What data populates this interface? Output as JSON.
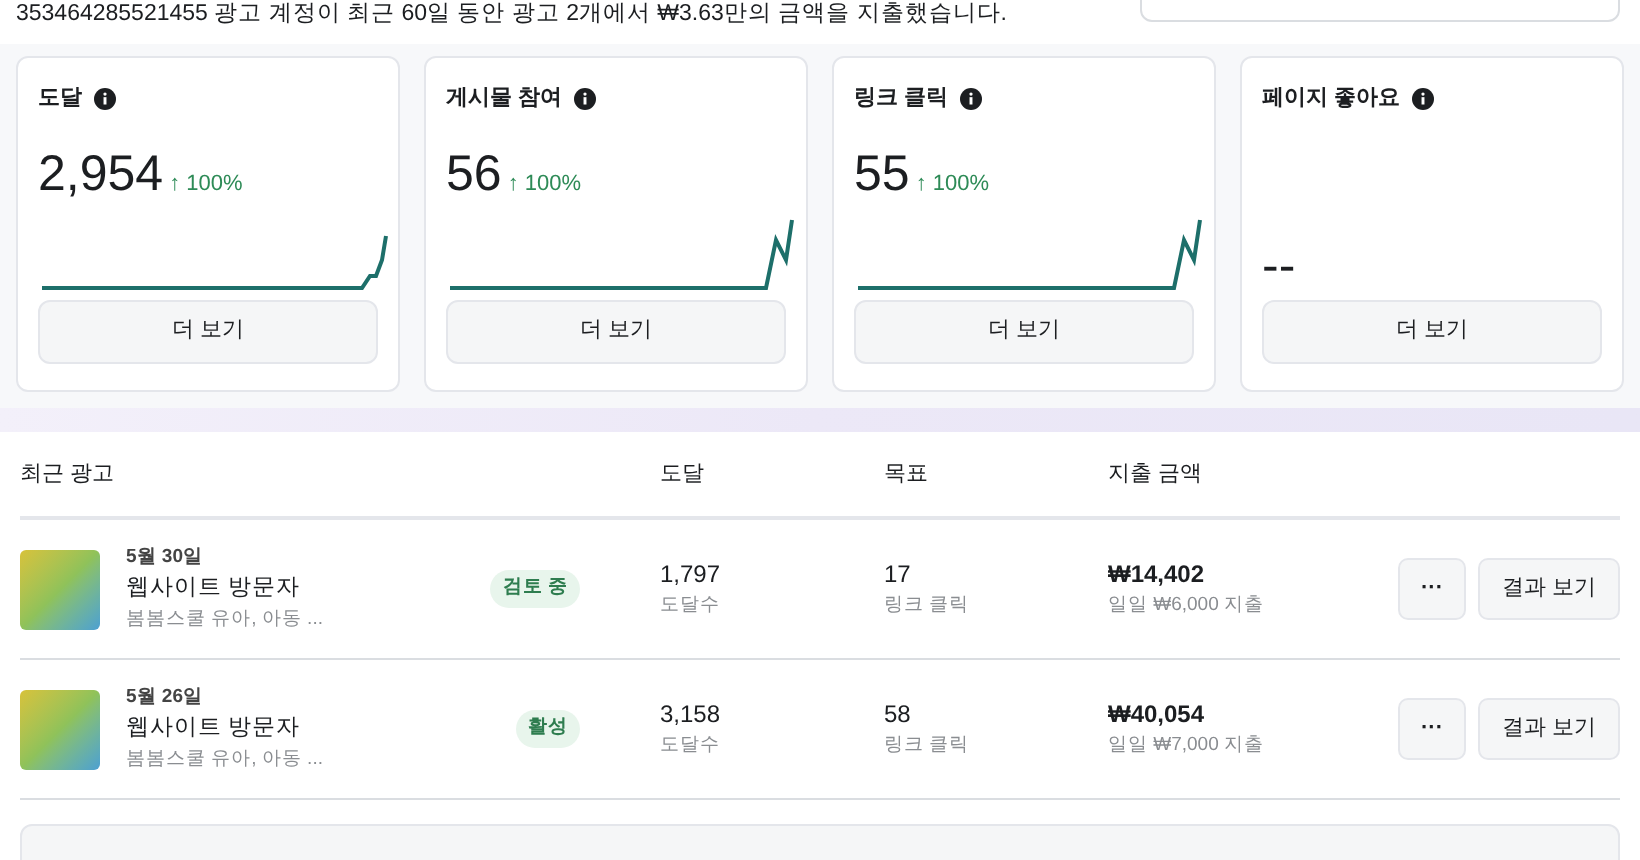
{
  "summary": "353464285521455 광고 계정이 최근 60일 동안 광고 2개에서 ₩3.63만의 금액을 지출했습니다.",
  "metrics": [
    {
      "label": "도달",
      "value": "2,954",
      "delta": "↑ 100%",
      "sparkline": true
    },
    {
      "label": "게시물 참여",
      "value": "56",
      "delta": "↑ 100%",
      "sparkline": true
    },
    {
      "label": "링크 클릭",
      "value": "55",
      "delta": "↑ 100%",
      "sparkline": true
    },
    {
      "label": "페이지 좋아요",
      "value": "--",
      "sparkline": false
    }
  ],
  "more_button": [
    "더 보기",
    "더 보기",
    "더 보기",
    "더 보기"
  ],
  "table": {
    "columns": [
      "최근 광고",
      "도달",
      "목표",
      "지출 금액"
    ],
    "rows": [
      {
        "date": "5월 30일",
        "name": "웹사이트 방문자",
        "audience": "봄봄스쿨 유아, 아동 ...",
        "status": "검토 중",
        "reach": "1,797",
        "reach_label": "도달수",
        "goal": "17",
        "goal_label": "링크 클릭",
        "spend": "₩14,402",
        "budget": "일일 ₩6,000 지출",
        "more": "···",
        "results": "결과 보기"
      },
      {
        "date": "5월 26일",
        "name": "웹사이트 방문자",
        "audience": "봄봄스쿨 유아, 아동 ...",
        "status": "활성",
        "reach": "3,158",
        "reach_label": "도달수",
        "goal": "58",
        "goal_label": "링크 클릭",
        "spend": "₩40,054",
        "budget": "일일 ₩7,000 지출",
        "more": "···",
        "results": "결과 보기"
      }
    ]
  }
}
